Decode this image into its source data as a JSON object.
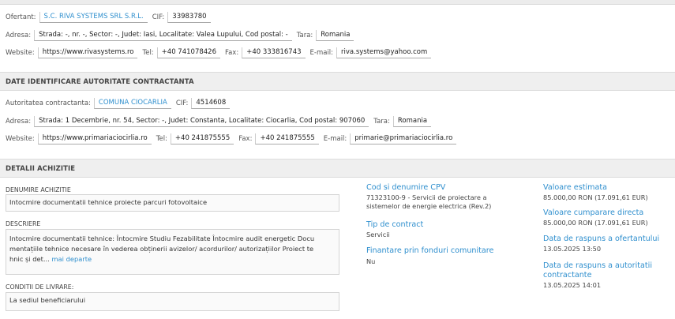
{
  "ofertant": {
    "ofertant_label": "Ofertant:",
    "ofertant_name": "S.C. RIVA SYSTEMS SRL S.R.L.",
    "cif_label": "CIF:",
    "cif": "33983780",
    "adresa_label": "Adresa:",
    "adresa": "Strada: -, nr. -, Sector: -, Judet: Iasi, Localitate: Valea Lupului, Cod postal: -",
    "tara_label": "Tara:",
    "tara": "Romania",
    "website_label": "Website:",
    "website": "https://www.rivasystems.ro",
    "tel_label": "Tel:",
    "tel": "+40 741078426",
    "fax_label": "Fax:",
    "fax": "+40 333816743",
    "email_label": "E-mail:",
    "email": "riva.systems@yahoo.com"
  },
  "autoritate": {
    "section_title": "DATE IDENTIFICARE AUTORITATE CONTRACTANTA",
    "autoritate_label": "Autoritatea contractanta:",
    "autoritate_name": "COMUNA CIOCARLIA",
    "cif_label": "CIF:",
    "cif": "4514608",
    "adresa_label": "Adresa:",
    "adresa": "Strada: 1 Decembrie, nr. 54, Sector: -, Judet: Constanta, Localitate: Ciocarlia, Cod postal: 907060",
    "tara_label": "Tara:",
    "tara": "Romania",
    "website_label": "Website:",
    "website": "https://www.primariaciocirlia.ro",
    "tel_label": "Tel:",
    "tel": "+40 241875555",
    "fax_label": "Fax:",
    "fax": "+40 241875555",
    "email_label": "E-mail:",
    "email": "primarie@primariaciocirlia.ro"
  },
  "achizitie": {
    "section_title": "DETALII ACHIZITIE",
    "denumire_label": "DENUMIRE ACHIZITIE",
    "denumire": "Intocmire documentatii tehnice proiecte parcuri fotovoltaice",
    "descriere_label": "DESCRIERE",
    "descriere_line1": "Intocmire documentatii tehnice: Întocmire Studiu Fezabilitate Întocmire audit energetic Docu",
    "descriere_line2": "mentațiile tehnice necesare în vederea obținerii avizelor/ acordurilor/ autorizațiilor Proiect te",
    "descriere_line3": "hnic și det...",
    "mai_departe": "mai departe",
    "conditii_label": "CONDITII DE LIVRARE:",
    "conditii": "La sediul beneficiarului",
    "cpv_title": "Cod si denumire CPV",
    "cpv_line1": "71323100-9 - Servicii de proiectare a",
    "cpv_line2": "sistemelor de energie electrica (Rev.2)",
    "tip_title": "Tip de contract",
    "tip_value": "Servicii",
    "finantare_title": "Finantare prin fonduri comunitare",
    "finantare_value": "Nu",
    "valoare_estimata_title": "Valoare estimata",
    "valoare_estimata": "85.000,00 RON (17.091,61 EUR)",
    "valoare_cumparare_title": "Valoare cumparare directa",
    "valoare_cumparare": "85.000,00 RON (17.091,61 EUR)",
    "data_ofertant_title": "Data de raspuns a ofertantului",
    "data_ofertant": "13.05.2025 13:50",
    "data_autoritate_title_line1": "Data de raspuns a autoritatii",
    "data_autoritate_title_line2": "contractante",
    "data_autoritate": "13.05.2025 14:01"
  }
}
